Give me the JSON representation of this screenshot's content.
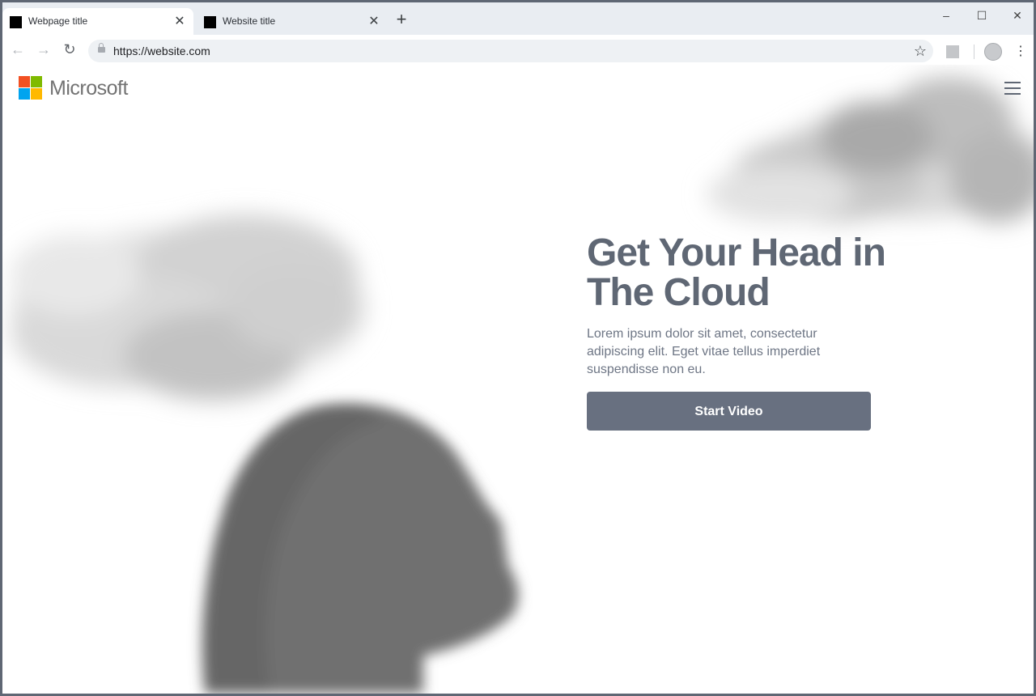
{
  "browser": {
    "tabs": [
      {
        "title": "Webpage title",
        "active": true
      },
      {
        "title": "Website title",
        "active": false
      }
    ],
    "new_tab_glyph": "+",
    "close_glyph": "✕",
    "window_controls": {
      "minimize": "–",
      "maximize": "☐",
      "close": "✕"
    },
    "url": "https://website.com",
    "nav": {
      "back": "←",
      "forward": "→",
      "reload": "↻"
    },
    "star_glyph": "☆",
    "menu_glyph": "⋮"
  },
  "site": {
    "logo_text": "Microsoft",
    "logo_colors": [
      "#f25022",
      "#7fba00",
      "#00a4ef",
      "#ffb900"
    ],
    "hero": {
      "title": "Get Your Head in The Cloud",
      "body": "Lorem ipsum dolor sit amet, consectetur adipiscing elit. Eget vitae tellus imperdiet suspendisse non eu.",
      "cta_label": "Start Video"
    }
  },
  "colors": {
    "accent": "#687080",
    "heading": "#5f6774",
    "frame": "#5f6774"
  }
}
